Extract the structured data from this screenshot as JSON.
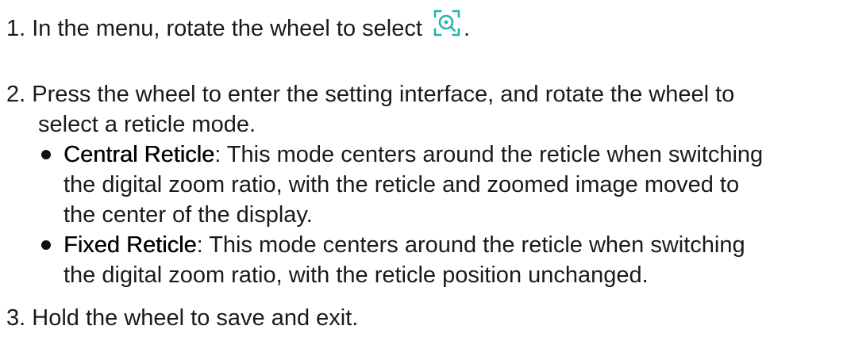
{
  "step1": {
    "number": "1.",
    "text": "In the menu, rotate the wheel to select",
    "icon": "reticle-icon",
    "icon_color": "#25b5a8",
    "trailing": "."
  },
  "step2": {
    "number": "2.",
    "line1": "Press the wheel to enter the setting interface, and rotate the wheel to",
    "line2": "select a reticle mode.",
    "bullets": [
      {
        "term": "Central Reticle",
        "line1": ": This mode centers around the reticle when switching",
        "line2": "the digital zoom ratio, with the reticle and zoomed image moved to",
        "line3": "the center of the display."
      },
      {
        "term": "Fixed Reticle",
        "line1": ": This mode centers around the reticle when switching",
        "line2": "the digital zoom ratio, with the reticle position unchanged."
      }
    ]
  },
  "step3": {
    "number": "3.",
    "text": "Hold the wheel to save and exit."
  }
}
